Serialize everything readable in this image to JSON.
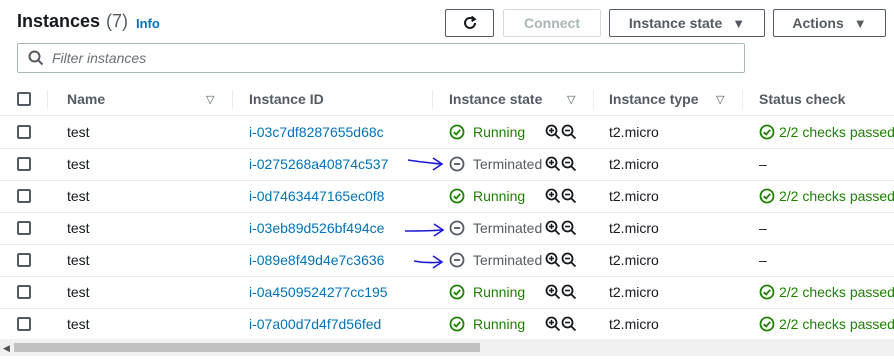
{
  "header": {
    "title": "Instances",
    "count": "(7)",
    "info_label": "Info",
    "buttons": {
      "refresh_icon": "refresh-icon",
      "connect": "Connect",
      "instance_state": "Instance state",
      "actions": "Actions"
    }
  },
  "search": {
    "placeholder": "Filter instances"
  },
  "table": {
    "columns": [
      "Name",
      "Instance ID",
      "Instance state",
      "Instance type",
      "Status check"
    ],
    "rows": [
      {
        "name": "test",
        "id": "i-03c7df8287655d68c",
        "state": "Running",
        "type": "t2.micro",
        "status": "2/2 checks passed"
      },
      {
        "name": "test",
        "id": "i-0275268a40874c537",
        "state": "Terminated",
        "type": "t2.micro",
        "status": "–"
      },
      {
        "name": "test",
        "id": "i-0d7463447165ec0f8",
        "state": "Running",
        "type": "t2.micro",
        "status": "2/2 checks passed"
      },
      {
        "name": "test",
        "id": "i-03eb89d526bf494ce",
        "state": "Terminated",
        "type": "t2.micro",
        "status": "–"
      },
      {
        "name": "test",
        "id": "i-089e8f49d4e7c3636",
        "state": "Terminated",
        "type": "t2.micro",
        "status": "–"
      },
      {
        "name": "test",
        "id": "i-0a4509524277cc195",
        "state": "Running",
        "type": "t2.micro",
        "status": "2/2 checks passed"
      },
      {
        "name": "test",
        "id": "i-07a00d7d4f7d56fed",
        "state": "Running",
        "type": "t2.micro",
        "status": "2/2 checks passed"
      }
    ]
  },
  "colors": {
    "link": "#0073bb",
    "running": "#1d8102",
    "terminated": "#545b64",
    "annotation_arrow": "#1a1ad6"
  }
}
